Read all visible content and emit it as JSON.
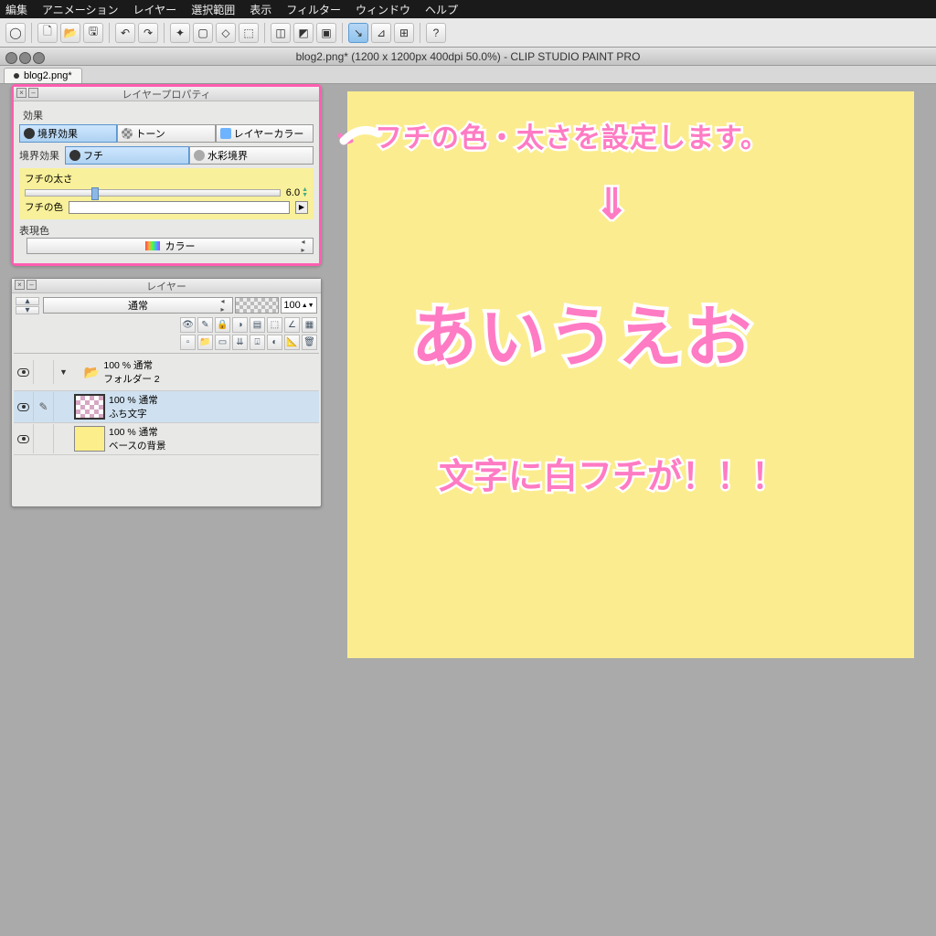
{
  "menu": {
    "items": [
      "編集",
      "アニメーション",
      "レイヤー",
      "選択範囲",
      "表示",
      "フィルター",
      "ウィンドウ",
      "ヘルプ"
    ]
  },
  "titlebar": "blog2.png* (1200 x 1200px 400dpi 50.0%)  - CLIP STUDIO PAINT PRO",
  "doc_tab": "blog2.png*",
  "prop": {
    "title": "レイヤープロパティ",
    "section_effect": "効果",
    "btn_border": "境界効果",
    "btn_tone": "トーン",
    "btn_layercolor": "レイヤーカラー",
    "label_border": "境界効果",
    "btn_fuchi": "フチ",
    "btn_water": "水彩境界",
    "label_thick": "フチの太さ",
    "val_thick": "6.0",
    "label_color": "フチの色",
    "label_expr": "表現色",
    "expr_val": "カラー"
  },
  "layers": {
    "title": "レイヤー",
    "blend": "通常",
    "opacity": "100",
    "folder": {
      "pct": "100 % 通常",
      "name": "フォルダー 2"
    },
    "l1": {
      "pct": "100 % 通常",
      "name": "ふち文字"
    },
    "l2": {
      "pct": "100 % 通常",
      "name": "ベースの背景"
    }
  },
  "canvas": {
    "note1": "フチの色・太さを設定します。",
    "note2": "⇓",
    "sample": "あいうえお",
    "note3": "文字に白フチが！！！"
  }
}
